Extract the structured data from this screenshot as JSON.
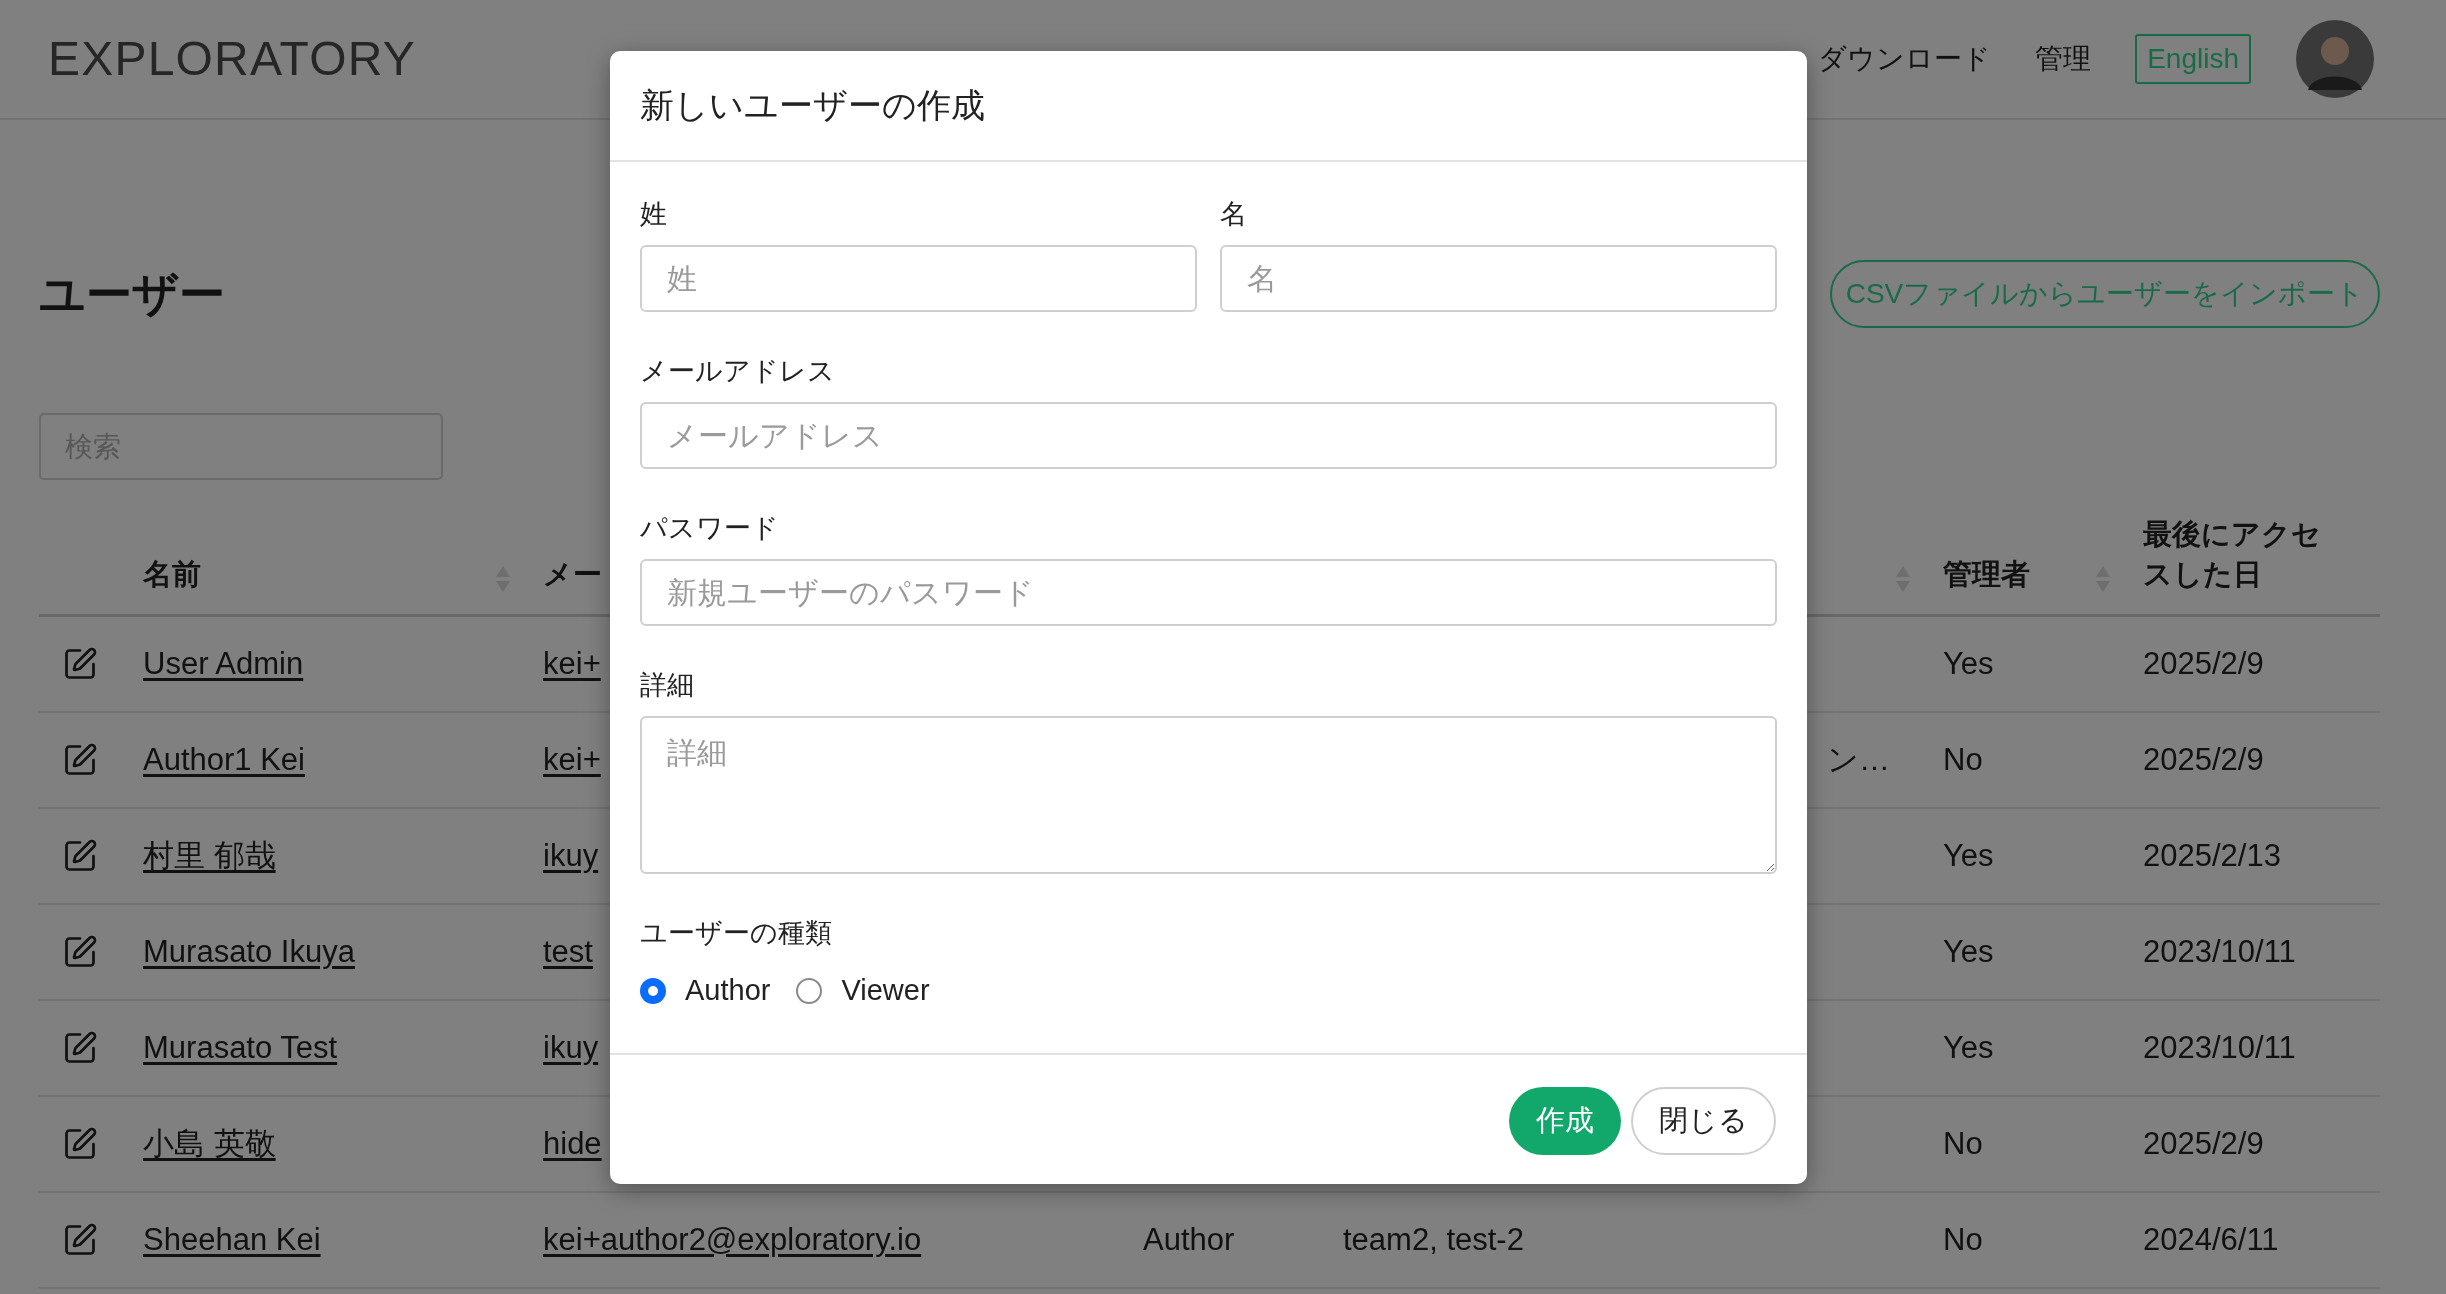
{
  "header": {
    "logo": "EXPLORATORY",
    "nav": [
      "ダウンロード",
      "管理"
    ],
    "language_button": "English"
  },
  "page": {
    "title": "ユーザー",
    "import_button": "CSVファイルからユーザーをインポート",
    "search": {
      "placeholder": "検索"
    }
  },
  "table": {
    "columns": [
      {
        "label": "名前",
        "sortable": true
      },
      {
        "label": "メー",
        "sortable": false
      },
      {
        "sortable": true
      },
      {
        "label": "管理者",
        "sortable": true
      },
      {
        "label": "最後にアクセスした日",
        "sortable": false
      }
    ],
    "rows": [
      {
        "name": "User Admin",
        "email": "kei+",
        "admin": "Yes",
        "last_access": "2025/2/9"
      },
      {
        "name": "Author1 Kei",
        "email": "kei+",
        "team": "ン…",
        "admin": "No",
        "last_access": "2025/2/9"
      },
      {
        "name": "村里 郁哉",
        "email": "ikuy",
        "admin": "Yes",
        "last_access": "2025/2/13"
      },
      {
        "name": "Murasato Ikuya",
        "email": "test",
        "admin": "Yes",
        "last_access": "2023/10/11"
      },
      {
        "name": "Murasato Test",
        "email": "ikuy",
        "admin": "Yes",
        "last_access": "2023/10/11"
      },
      {
        "name": "小島 英敬",
        "email": "hide",
        "admin": "No",
        "last_access": "2025/2/9"
      },
      {
        "name": "Sheehan Kei",
        "email": "kei+author2@exploratory.io",
        "type": "Author",
        "team": "team2, test-2",
        "admin": "No",
        "last_access": "2024/6/11"
      }
    ]
  },
  "modal": {
    "title": "新しいユーザーの作成",
    "fields": [
      {
        "kind": "half",
        "label": "姓",
        "placeholder": "姓"
      },
      {
        "kind": "half",
        "label": "名",
        "placeholder": "名"
      },
      {
        "kind": "text",
        "label": "メールアドレス",
        "placeholder": "メールアドレス"
      },
      {
        "kind": "text",
        "label": "パスワード",
        "placeholder": "新規ユーザーのパスワード"
      },
      {
        "kind": "textarea",
        "label": "詳細",
        "placeholder": "詳細"
      }
    ],
    "user_type": {
      "label": "ユーザーの種類",
      "options": [
        {
          "label": "Author",
          "selected": true
        },
        {
          "label": "Viewer",
          "selected": false
        }
      ]
    },
    "buttons": [
      {
        "label": "作成",
        "kind": "primary"
      },
      {
        "label": "閉じる",
        "kind": "secondary"
      }
    ]
  }
}
